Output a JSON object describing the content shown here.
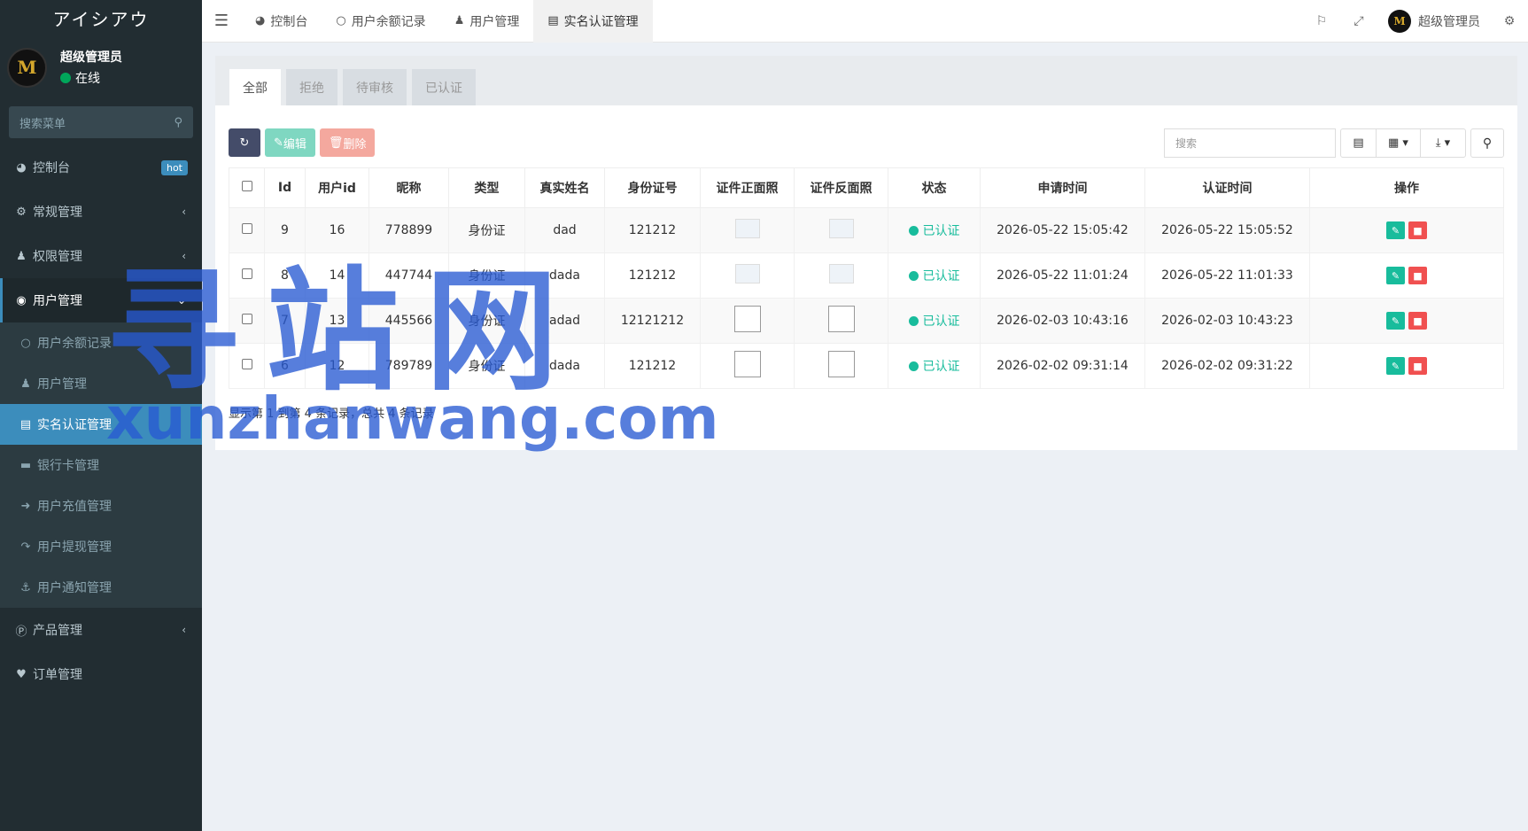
{
  "brand": "アイシアウ",
  "user": {
    "name": "超级管理员",
    "status": "在线",
    "avatar_text": "M"
  },
  "sidebar": {
    "search_placeholder": "搜索菜单",
    "items": [
      {
        "label": "控制台",
        "icon": "dashboard-icon",
        "badge": "hot"
      },
      {
        "label": "常规管理",
        "icon": "cogs-icon"
      },
      {
        "label": "权限管理",
        "icon": "group-icon"
      },
      {
        "label": "用户管理",
        "icon": "user-circle-icon"
      }
    ],
    "sub": [
      {
        "label": "用户余额记录",
        "icon": "circle-icon"
      },
      {
        "label": "用户管理",
        "icon": "user-icon"
      },
      {
        "label": "实名认证管理",
        "icon": "id-card-icon"
      },
      {
        "label": "银行卡管理",
        "icon": "credit-card-icon"
      },
      {
        "label": "用户充值管理",
        "icon": "sign-in-icon"
      },
      {
        "label": "用户提现管理",
        "icon": "sign-out-icon"
      },
      {
        "label": "用户通知管理",
        "icon": "anchor-icon"
      }
    ],
    "bottom": [
      {
        "label": "产品管理",
        "icon": "product-icon"
      },
      {
        "label": "订单管理",
        "icon": "heartbeat-icon"
      }
    ]
  },
  "header": {
    "tabs": [
      {
        "label": "控制台"
      },
      {
        "label": "用户余额记录"
      },
      {
        "label": "用户管理"
      },
      {
        "label": "实名认证管理"
      }
    ],
    "admin": "超级管理员"
  },
  "filter_tabs": [
    "全部",
    "拒绝",
    "待审核",
    "已认证"
  ],
  "toolbar": {
    "edit": "编辑",
    "delete": "删除",
    "search_placeholder": "搜索"
  },
  "table": {
    "columns": [
      "Id",
      "用户id",
      "昵称",
      "类型",
      "真实姓名",
      "身份证号",
      "证件正面照",
      "证件反面照",
      "状态",
      "申请时间",
      "认证时间",
      "操作"
    ],
    "rows": [
      {
        "id": "9",
        "uid": "16",
        "nick": "778899",
        "type": "身份证",
        "name": "dad",
        "idno": "121212",
        "status": "已认证",
        "apply": "2026-05-22 15:05:42",
        "verify": "2026-05-22 15:05:52",
        "img": "thumb"
      },
      {
        "id": "8",
        "uid": "14",
        "nick": "447744",
        "type": "身份证",
        "name": "dada",
        "idno": "121212",
        "status": "已认证",
        "apply": "2026-05-22 11:01:24",
        "verify": "2026-05-22 11:01:33",
        "img": "thumb"
      },
      {
        "id": "7",
        "uid": "13",
        "nick": "445566",
        "type": "身份证",
        "name": "adad",
        "idno": "12121212",
        "status": "已认证",
        "apply": "2026-02-03 10:43:16",
        "verify": "2026-02-03 10:43:23",
        "img": "broken"
      },
      {
        "id": "6",
        "uid": "12",
        "nick": "789789",
        "type": "身份证",
        "name": "dada",
        "idno": "121212",
        "status": "已认证",
        "apply": "2026-02-02 09:31:14",
        "verify": "2026-02-02 09:31:22",
        "img": "broken"
      }
    ]
  },
  "pagination_info": "显示第 1 到第 4 条记录，总共 4 条记录",
  "watermark": {
    "cn": "寻站网",
    "en": "xunzhanwang.com"
  }
}
